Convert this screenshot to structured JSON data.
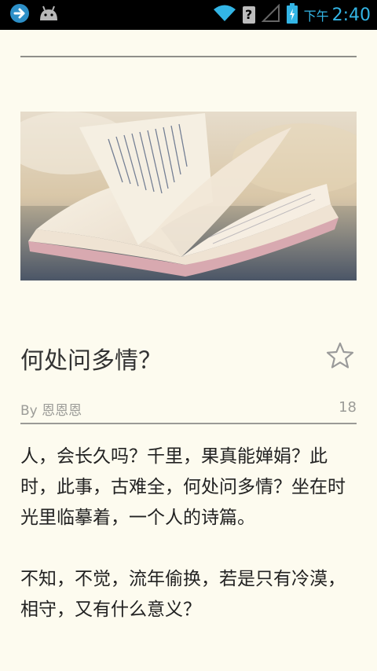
{
  "status_bar": {
    "time_ampm": "下午",
    "time": "2:40",
    "sim_indicator": "?",
    "icons": [
      "nav-arrow-icon",
      "android-icon",
      "wifi-icon",
      "sim-unknown-icon",
      "signal-icon",
      "battery-charging-icon"
    ],
    "accent_color": "#33b5e5"
  },
  "article": {
    "title": "何处问多情？",
    "author": "By 恩恩恩",
    "count": "18",
    "favorite_icon": "star-outline-icon",
    "paragraphs": [
      "人，会长久吗？千里，果真能婵娟？此时，此事，古难全，何处问多情？坐在时光里临摹着，一个人的诗篇。",
      "不知，不觉，流年偷换，若是只有冷漠，相守，又有什么意义？"
    ]
  },
  "colors": {
    "background": "#fdfbef",
    "text": "#222222",
    "meta": "#9c9c98"
  }
}
